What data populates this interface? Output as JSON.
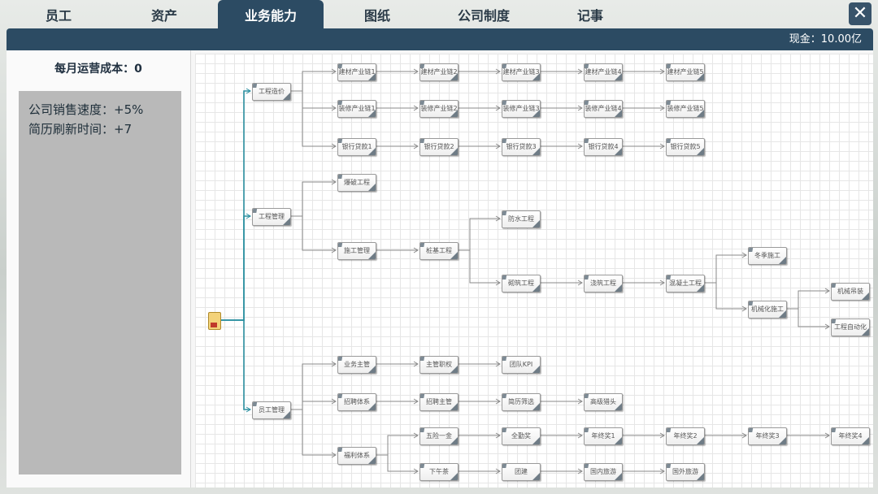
{
  "tabs": [
    {
      "label": "员工",
      "active": false
    },
    {
      "label": "资产",
      "active": false
    },
    {
      "label": "业务能力",
      "active": true
    },
    {
      "label": "图纸",
      "active": false
    },
    {
      "label": "公司制度",
      "active": false
    },
    {
      "label": "记事",
      "active": false
    }
  ],
  "close_label": "✕",
  "header": {
    "cash": "现金：10.00亿"
  },
  "left": {
    "monthly_cost": "每月运营成本：0",
    "effects": [
      "公司销售速度：+5%",
      "简历刷新时间：+7"
    ]
  },
  "tree": {
    "root_label": "",
    "nodes": [
      {
        "id": "n1",
        "label": "工程造价"
      },
      {
        "id": "n2",
        "label": "工程管理"
      },
      {
        "id": "n3",
        "label": "员工管理"
      },
      {
        "id": "a1",
        "label": "建材产业链1"
      },
      {
        "id": "a2",
        "label": "建材产业链2"
      },
      {
        "id": "a3",
        "label": "建材产业链3"
      },
      {
        "id": "a4",
        "label": "建材产业链4"
      },
      {
        "id": "a5",
        "label": "建材产业链5"
      },
      {
        "id": "b1",
        "label": "装修产业链1"
      },
      {
        "id": "b2",
        "label": "装修产业链2"
      },
      {
        "id": "b3",
        "label": "装修产业链3"
      },
      {
        "id": "b4",
        "label": "装修产业链4"
      },
      {
        "id": "b5",
        "label": "装修产业链5"
      },
      {
        "id": "c1",
        "label": "银行贷款1"
      },
      {
        "id": "c2",
        "label": "银行贷款2"
      },
      {
        "id": "c3",
        "label": "银行贷款3"
      },
      {
        "id": "c4",
        "label": "银行贷款4"
      },
      {
        "id": "c5",
        "label": "银行贷款5"
      },
      {
        "id": "d1",
        "label": "爆破工程"
      },
      {
        "id": "d2",
        "label": "施工管理"
      },
      {
        "id": "d3",
        "label": "桩基工程"
      },
      {
        "id": "d4",
        "label": "防水工程"
      },
      {
        "id": "d5",
        "label": "砌筑工程"
      },
      {
        "id": "d6",
        "label": "浇筑工程"
      },
      {
        "id": "d7",
        "label": "混凝土工程"
      },
      {
        "id": "d8",
        "label": "冬季施工"
      },
      {
        "id": "d9",
        "label": "机械化施工"
      },
      {
        "id": "d10",
        "label": "机械吊装"
      },
      {
        "id": "d11",
        "label": "工程自动化"
      },
      {
        "id": "e1",
        "label": "业务主管"
      },
      {
        "id": "e2",
        "label": "主管职权"
      },
      {
        "id": "e3",
        "label": "团队KPI"
      },
      {
        "id": "e4",
        "label": "招聘体系"
      },
      {
        "id": "e5",
        "label": "招聘主管"
      },
      {
        "id": "e6",
        "label": "简历筛选"
      },
      {
        "id": "e7",
        "label": "高级猎头"
      },
      {
        "id": "e8",
        "label": "福利体系"
      },
      {
        "id": "e9",
        "label": "五险一金"
      },
      {
        "id": "e10",
        "label": "全勤奖"
      },
      {
        "id": "e11",
        "label": "年终奖1"
      },
      {
        "id": "e12",
        "label": "年终奖2"
      },
      {
        "id": "e13",
        "label": "年终奖3"
      },
      {
        "id": "e14",
        "label": "年终奖4"
      },
      {
        "id": "e15",
        "label": "下午茶"
      },
      {
        "id": "e16",
        "label": "团建"
      },
      {
        "id": "e17",
        "label": "国内旅游"
      },
      {
        "id": "e18",
        "label": "国外旅游"
      }
    ]
  }
}
